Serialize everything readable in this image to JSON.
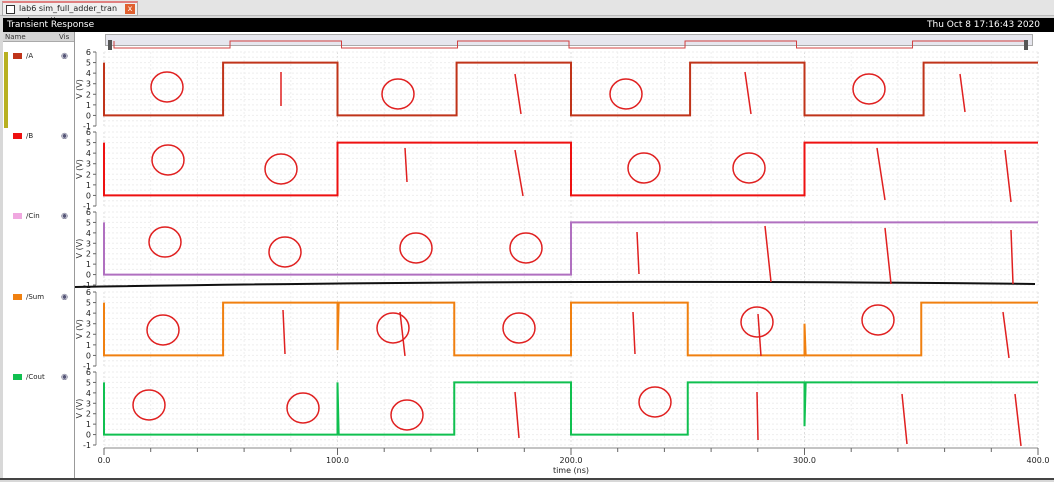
{
  "tab": {
    "title": "lab6 sim_full_adder_tran schematic",
    "close": "x"
  },
  "window": {
    "title": "Transient Response",
    "datetime": "Thu Oct 8 17:16:43 2020"
  },
  "signal_list": {
    "col_name": "Name",
    "col_vis": "Vis",
    "signals": [
      {
        "name": "/A",
        "color": "#c0341a"
      },
      {
        "name": "/B",
        "color": "#ee1111"
      },
      {
        "name": "/Cin",
        "color": "#f0a8e0"
      },
      {
        "name": "/Sum",
        "color": "#f08010"
      },
      {
        "name": "/Cout",
        "color": "#10c050"
      }
    ]
  },
  "chart_data": {
    "type": "line",
    "xlabel": "time (ns)",
    "ylabel": "V (V)",
    "xlim": [
      0,
      400
    ],
    "ylim": [
      -1,
      6
    ],
    "xticks": [
      "0.0",
      "100.0",
      "200.0",
      "300.0",
      "400.0"
    ],
    "yticks": [
      "-1",
      "0",
      "1",
      "2",
      "3",
      "4",
      "5",
      "6"
    ],
    "series": [
      {
        "name": "/A",
        "color": "#c0341a",
        "points": [
          [
            0,
            5
          ],
          [
            0,
            0
          ],
          [
            51,
            0
          ],
          [
            51,
            5
          ],
          [
            100,
            5
          ],
          [
            100,
            0
          ],
          [
            151,
            0
          ],
          [
            151,
            5
          ],
          [
            200,
            5
          ],
          [
            200,
            0
          ],
          [
            251,
            0
          ],
          [
            251,
            5
          ],
          [
            300,
            5
          ],
          [
            300,
            0
          ],
          [
            351,
            0
          ],
          [
            351,
            5
          ],
          [
            400,
            5
          ]
        ]
      },
      {
        "name": "/B",
        "color": "#ee1111",
        "points": [
          [
            0,
            5
          ],
          [
            0,
            0
          ],
          [
            100,
            0
          ],
          [
            100,
            5
          ],
          [
            200,
            5
          ],
          [
            200,
            0
          ],
          [
            300,
            0
          ],
          [
            300,
            5
          ],
          [
            400,
            5
          ]
        ]
      },
      {
        "name": "/Cin",
        "color": "#b070c0",
        "points": [
          [
            0,
            5
          ],
          [
            0,
            0
          ],
          [
            200,
            0
          ],
          [
            200,
            5
          ],
          [
            400,
            5
          ]
        ]
      },
      {
        "name": "/Sum",
        "color": "#f08010",
        "points": [
          [
            0,
            5
          ],
          [
            0,
            0
          ],
          [
            51,
            0
          ],
          [
            51,
            5
          ],
          [
            100,
            5
          ],
          [
            100,
            0.5
          ],
          [
            100.5,
            5
          ],
          [
            150,
            5
          ],
          [
            150,
            0
          ],
          [
            200,
            0
          ],
          [
            200,
            5
          ],
          [
            250,
            5
          ],
          [
            250,
            0
          ],
          [
            300,
            0
          ],
          [
            300,
            3
          ],
          [
            300.5,
            0
          ],
          [
            350,
            0
          ],
          [
            350,
            5
          ],
          [
            400,
            5
          ]
        ]
      },
      {
        "name": "/Cout",
        "color": "#10c050",
        "points": [
          [
            0,
            5
          ],
          [
            0,
            0
          ],
          [
            100,
            0
          ],
          [
            100,
            5
          ],
          [
            100.5,
            0
          ],
          [
            150,
            0
          ],
          [
            150,
            5
          ],
          [
            200,
            5
          ],
          [
            200,
            0
          ],
          [
            250,
            0
          ],
          [
            250,
            5
          ],
          [
            300,
            5
          ],
          [
            300,
            0.8
          ],
          [
            300.5,
            5
          ],
          [
            400,
            5
          ]
        ]
      }
    ]
  }
}
